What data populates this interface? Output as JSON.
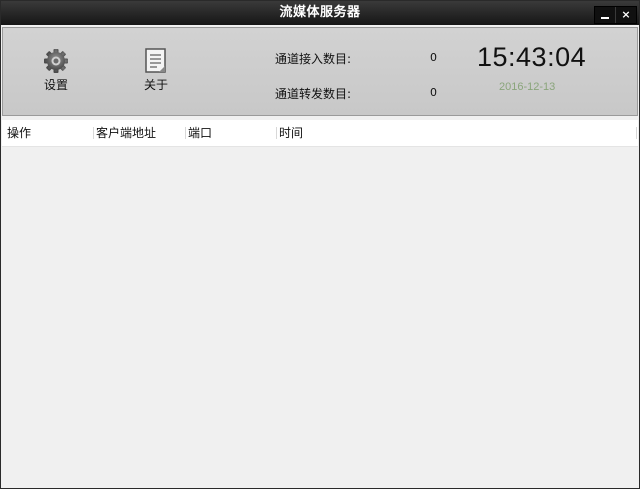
{
  "window": {
    "title": "流媒体服务器",
    "minimize_icon": "minimize-icon",
    "close_label": "×"
  },
  "toolbar": {
    "settings_label": "设置",
    "settings_icon": "gear-icon",
    "about_label": "关于",
    "about_icon": "document-icon"
  },
  "stats": {
    "channel_in_label": "通道接入数目:",
    "channel_in_value": "0",
    "channel_out_label": "通道转发数目:",
    "channel_out_value": "0"
  },
  "clock": {
    "time": "15:43:04",
    "date": "2016-12-13"
  },
  "table": {
    "columns": [
      "操作",
      "客户端地址",
      "端口",
      "时间"
    ],
    "rows": []
  },
  "colors": {
    "titlebar": "#1e1e1e",
    "toolbar": "#cccccc",
    "date_text": "#8aa57b"
  }
}
